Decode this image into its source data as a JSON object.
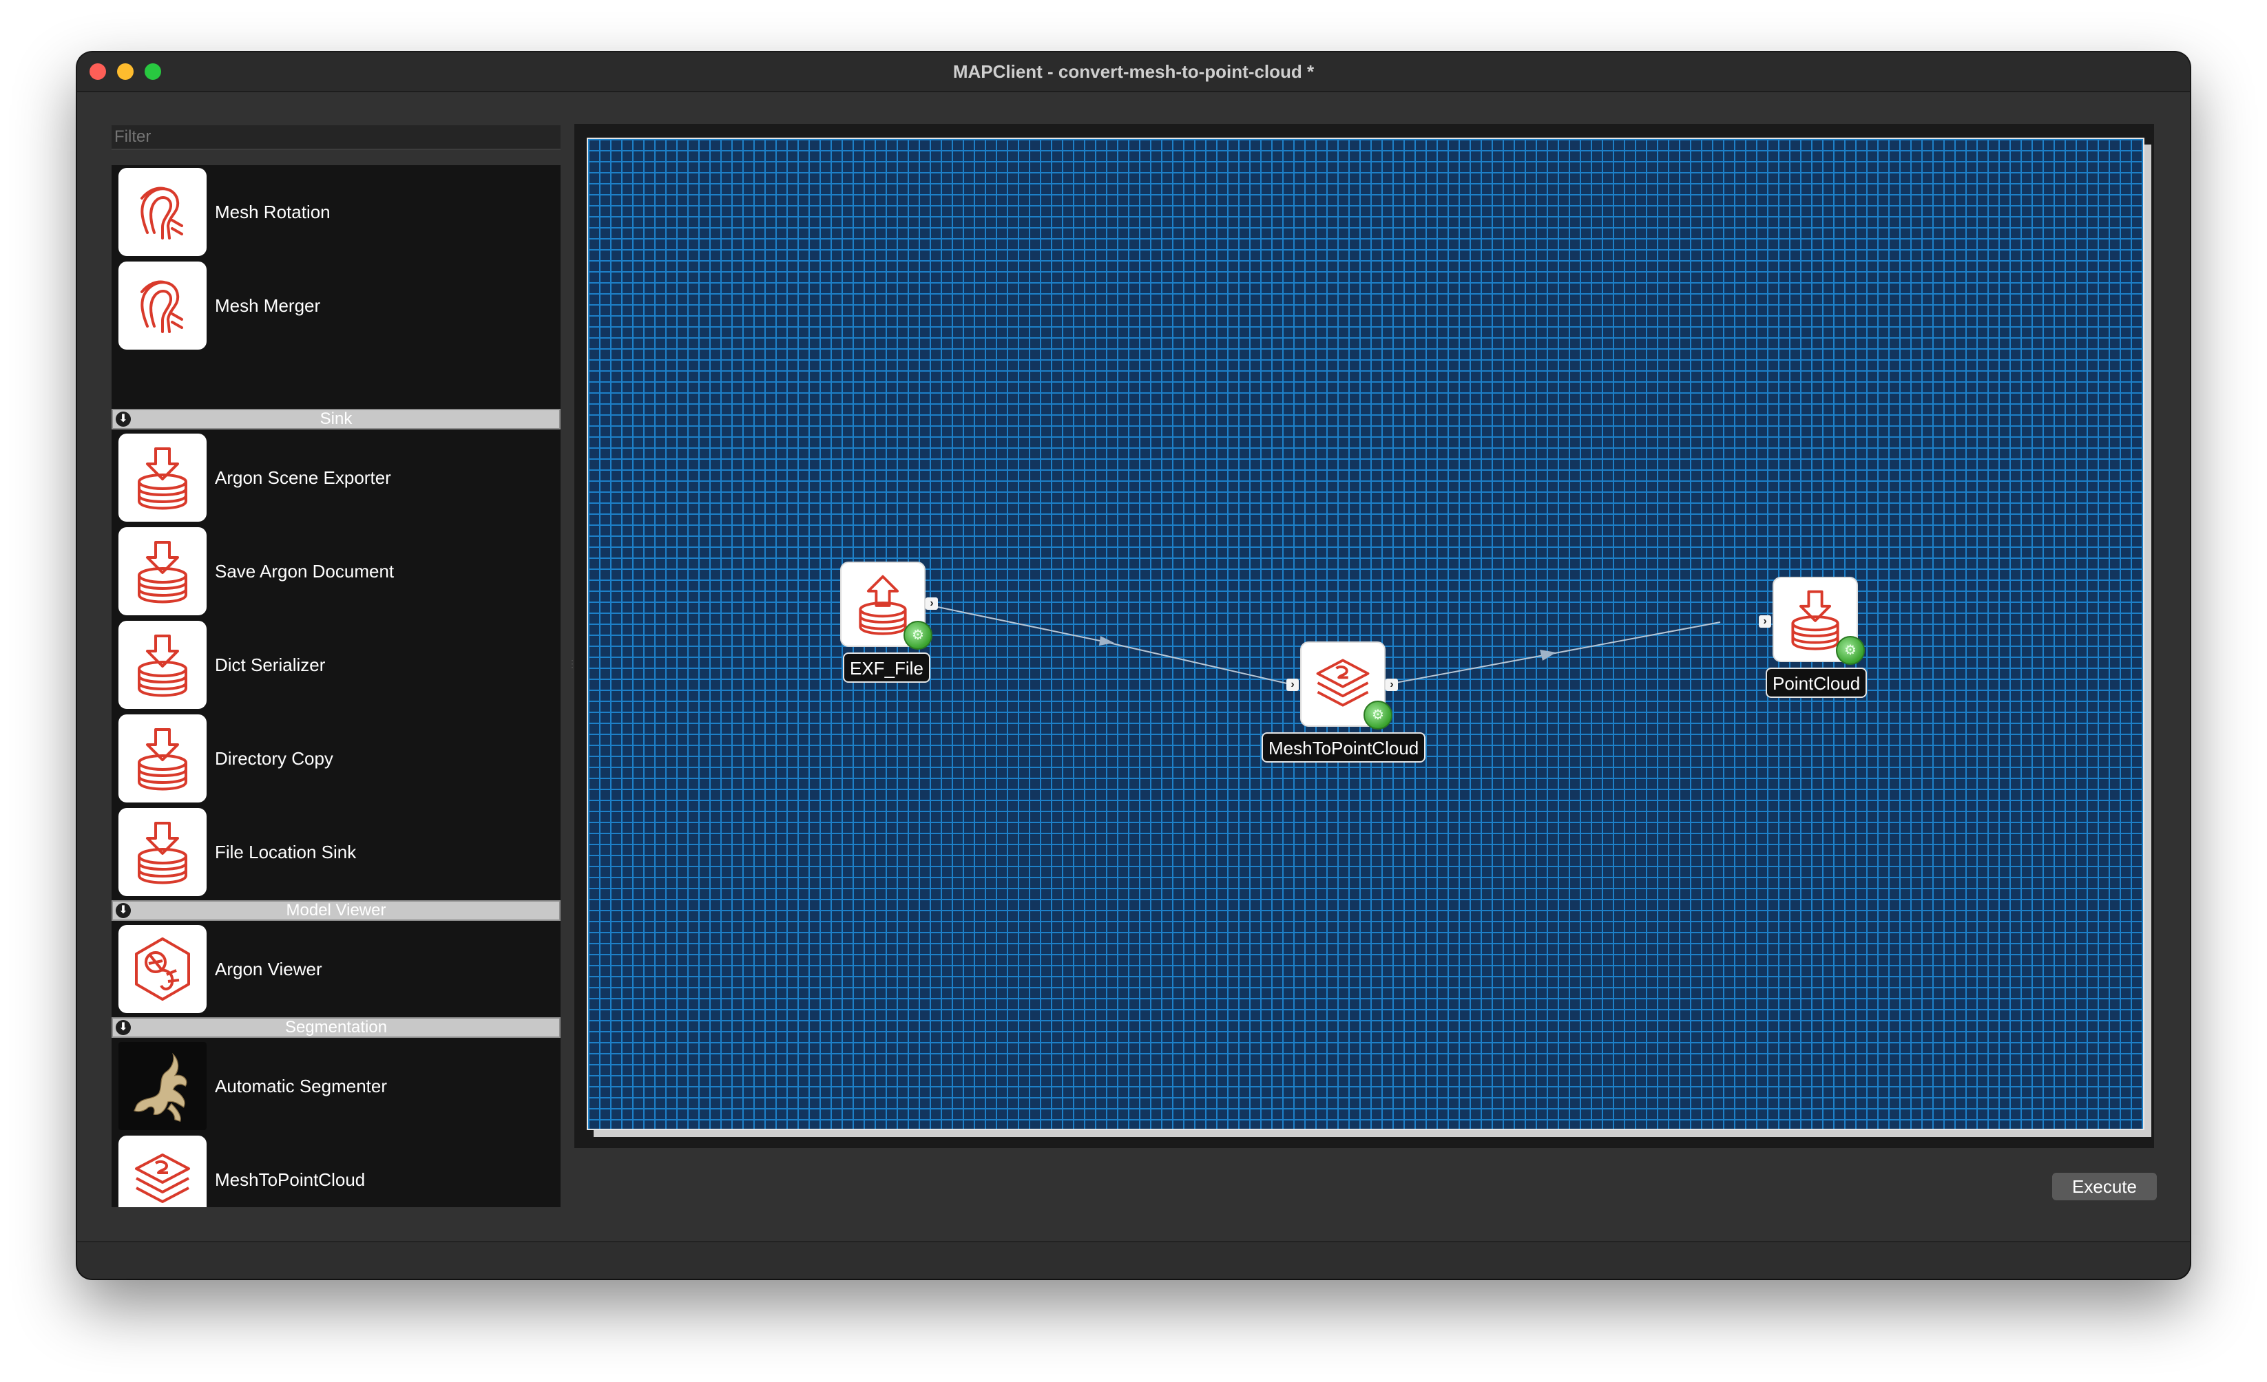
{
  "window": {
    "title": "MAPClient - convert-mesh-to-point-cloud *"
  },
  "filter": {
    "placeholder": "Filter"
  },
  "step_list": {
    "items": [
      {
        "kind": "step",
        "label": "Mesh Rotation",
        "icon": "mesh-rotation-icon"
      },
      {
        "kind": "step",
        "label": "Mesh Merger",
        "icon": "mesh-merger-icon"
      },
      {
        "kind": "category",
        "label": "Sink"
      },
      {
        "kind": "step",
        "label": "Argon Scene Exporter",
        "icon": "sink-icon"
      },
      {
        "kind": "step",
        "label": "Save Argon Document",
        "icon": "sink-icon"
      },
      {
        "kind": "step",
        "label": "Dict Serializer",
        "icon": "sink-icon"
      },
      {
        "kind": "step",
        "label": "Directory Copy",
        "icon": "sink-icon"
      },
      {
        "kind": "step",
        "label": "File Location Sink",
        "icon": "sink-icon"
      },
      {
        "kind": "category",
        "label": "Model Viewer"
      },
      {
        "kind": "step",
        "label": "Argon Viewer",
        "icon": "argon-viewer-icon"
      },
      {
        "kind": "category",
        "label": "Segmentation"
      },
      {
        "kind": "step",
        "label": "Automatic Segmenter",
        "icon": "automatic-segmenter-thumbnail"
      },
      {
        "kind": "step",
        "label": "MeshToPointCloud",
        "icon": "mesh-to-point-cloud-icon"
      }
    ]
  },
  "workflow": {
    "nodes": [
      {
        "label": "EXF_File",
        "icon": "source-upload-icon"
      },
      {
        "label": "MeshToPointCloud",
        "icon": "mesh-to-point-cloud-icon"
      },
      {
        "label": "PointCloud",
        "icon": "sink-icon"
      }
    ],
    "edges": [
      {
        "from": "EXF_File",
        "to": "MeshToPointCloud"
      },
      {
        "from": "MeshToPointCloud",
        "to": "PointCloud"
      }
    ]
  },
  "buttons": {
    "execute": "Execute"
  },
  "colors": {
    "icon_red": "#d93a2b",
    "canvas_background": "#12355e",
    "grid_line": "#1d80c8",
    "status_ok": "#3aa32e"
  }
}
